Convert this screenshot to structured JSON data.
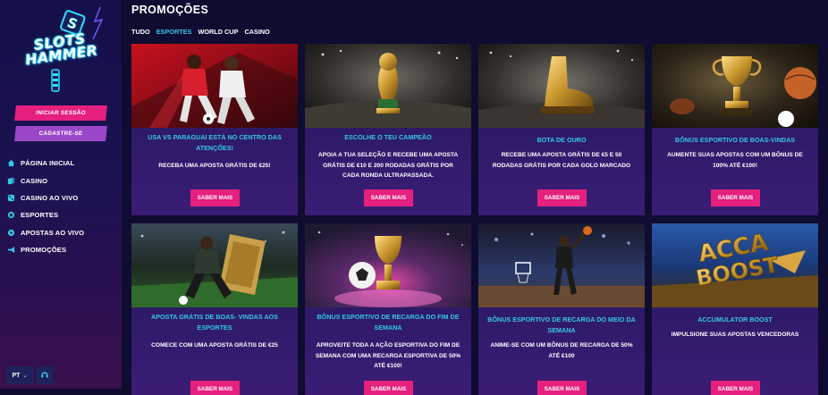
{
  "brand": {
    "line1": "SLOTS",
    "line2": "HAMMER"
  },
  "sidebar": {
    "login_label": "INICIAR SESSÃO",
    "register_label": "CADASTRE-SE",
    "nav": [
      {
        "label": "PÁGINA INICIAL",
        "icon": "home-icon"
      },
      {
        "label": "CASINO",
        "icon": "cards-icon"
      },
      {
        "label": "CASINO AO VIVO",
        "icon": "live-casino-icon"
      },
      {
        "label": "ESPORTES",
        "icon": "ball-icon"
      },
      {
        "label": "APOSTAS AO VIVO",
        "icon": "live-bet-icon"
      },
      {
        "label": "PROMOÇÕES",
        "icon": "megaphone-icon"
      }
    ],
    "language": "PT"
  },
  "main": {
    "title": "PROMOÇÕES",
    "tabs": [
      {
        "label": "TUDO",
        "active": false
      },
      {
        "label": "ESPORTES",
        "active": true
      },
      {
        "label": "WORLD CUP",
        "active": false
      },
      {
        "label": "CASINO",
        "active": false
      }
    ],
    "promotions": [
      {
        "title": "USA VS PARAGUAI ESTÁ NO CENTRO DAS ATENÇÕES!",
        "description": "RECEBA UMA APOSTA GRÁTIS DE €25!",
        "button": "SABER MAIS"
      },
      {
        "title": "ESCOLHE O TEU CAMPEÃO",
        "description": "APOIA A TUA SELEÇÃO E RECEBE UMA APOSTA GRÁTIS DE €10 E 200 RODADAS GRÁTIS POR CADA RONDA ULTRAPASSADA.",
        "button": "SABER MAIS"
      },
      {
        "title": "BOTA DE OURO",
        "description": "RECEBE UMA APOSTA GRÁTIS DE €5 E 50 RODADAS GRÁTIS POR CADA GOLO MARCADO",
        "button": "SABER MAIS"
      },
      {
        "title": "BÔNUS ESPORTIVO DE BOAS-VINDAS",
        "description": "AUMENTE SUAS APOSTAS COM UM BÔNUS DE 100% ATÉ €100!",
        "button": "SABER MAIS"
      },
      {
        "title": "APOSTA GRÁTIS DE BOAS- VINDAS AOS ESPORTES",
        "description": "COMECE COM UMA APOSTA GRÁTIS DE €25",
        "button": "SABER MAIS"
      },
      {
        "title": "BÔNUS ESPORTIVO DE RECARGA DO FIM DE SEMANA",
        "description": "APROVEITE TODA A AÇÃO ESPORTIVA DO FIM DE SEMANA COM UMA RECARGA ESPORTIVA DE 50% ATÉ €100!",
        "button": "SABER MAIS"
      },
      {
        "title": "BÔNUS ESPORTIVO DE RECARGA DO MEIO DA SEMANA",
        "description": "ANIME-SE COM UM BÔNUS DE RECARGA DE 50% ATÉ €100",
        "button": "SABER MAIS"
      },
      {
        "title": "ACCUMULATOR BOOST",
        "description": "IMPULSIONE SUAS APOSTAS VENCEDORAS",
        "button": "SABER MAIS",
        "image_text": {
          "line1": "ACCA",
          "line2": "BOOST"
        }
      }
    ]
  },
  "colors": {
    "accent_pink": "#e5207f",
    "accent_purple": "#9b47c9",
    "accent_cyan": "#35c6e8",
    "background": "#0e0c30"
  }
}
